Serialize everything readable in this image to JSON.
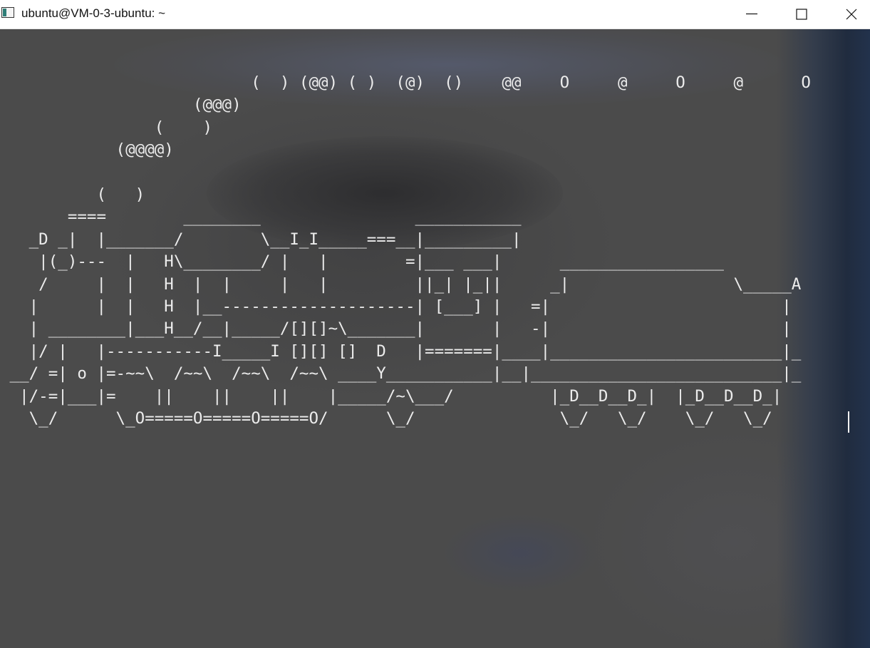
{
  "window": {
    "title": "ubuntu@VM-0-3-ubuntu: ~",
    "app_icon": "terminal-icon",
    "controls": {
      "minimize_icon": "minimize-icon",
      "maximize_icon": "maximize-icon",
      "close_icon": "close-icon"
    }
  },
  "terminal": {
    "background_color": "#4b4b4b",
    "foreground_color": "#ececec",
    "lines": [
      "                          (  ) (@@) ( )  (@)  ()    @@    O     @     O     @      O",
      "                    (@@@)",
      "                (    )",
      "            (@@@@)",
      "",
      "          (   )",
      "       ====        ________                ___________",
      "   _D _|  |_______/        \\__I_I_____===__|_________|",
      "    |(_)---  |   H\\________/ |   |        =|___ ___|      _________________",
      "    /     |  |   H  |  |     |   |         ||_| |_||     _|                 \\_____A",
      "   |      |  |   H  |__--------------------| [___] |   =|                        |",
      "   | ________|___H__/__|_____/[][]~\\_______|       |   -|                        |",
      "   |/ |   |-----------I_____I [][] []  D   |=======|____|________________________|_",
      " __/ =| o |=-~~\\  /~~\\  /~~\\  /~~\\ ____Y___________|__|__________________________|_",
      "  |/-=|___|=    ||    ||    ||    |_____/~\\___/          |_D__D__D_|  |_D__D__D_|",
      "   \\_/      \\_O=====O=====O=====O/      \\_/               \\_/   \\_/    \\_/   \\_/"
    ]
  }
}
